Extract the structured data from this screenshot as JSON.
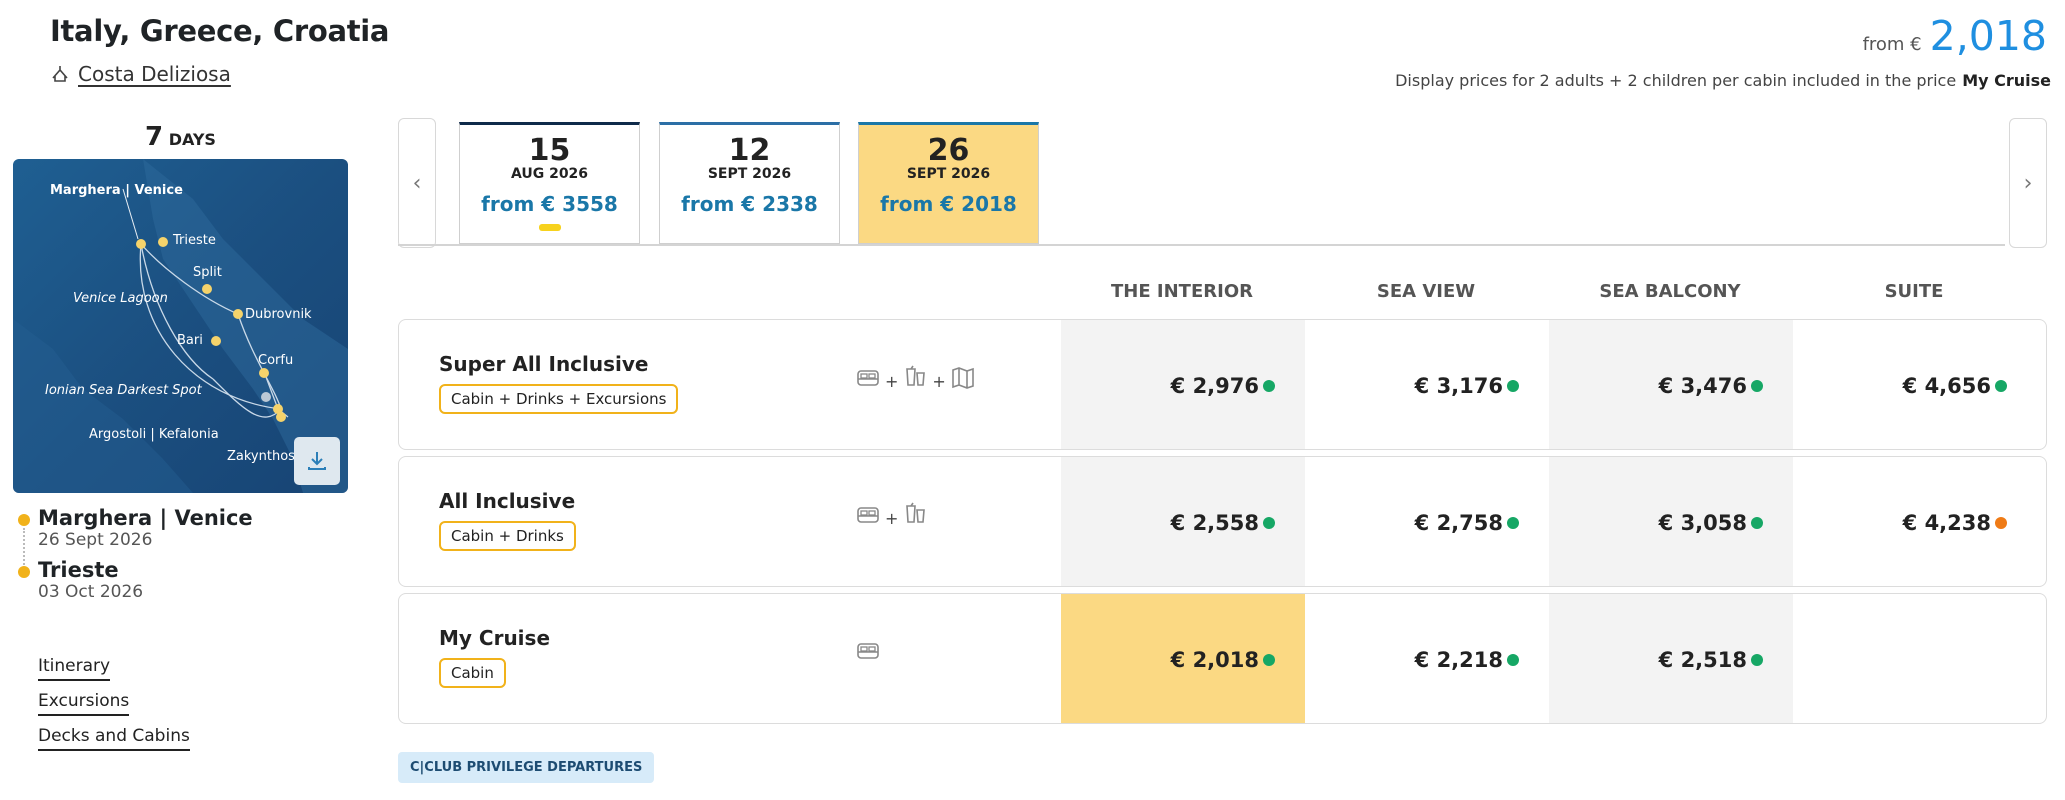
{
  "header": {
    "title": "Italy, Greece, Croatia",
    "ship": "Costa Deliziosa",
    "from_label": "from €",
    "from_price": "2,018",
    "note": "Display prices for 2 adults + 2 children per cabin included in the price",
    "note_bold": "My Cruise"
  },
  "sidebar": {
    "days_num": "7",
    "days_label": "DAYS",
    "map_labels": {
      "start": "Marghera | Venice",
      "trieste": "Trieste",
      "split": "Split",
      "lagoon": "Venice Lagoon",
      "dubrovnik": "Dubrovnik",
      "bari": "Bari",
      "corfu": "Corfu",
      "ionian": "Ionian Sea Darkest Spot",
      "argostoli": "Argostoli | Kefalonia",
      "zakynthos": "Zakynthos"
    },
    "ports": [
      {
        "name": "Marghera | Venice",
        "date": "26 Sept 2026"
      },
      {
        "name": "Trieste",
        "date": "03 Oct 2026"
      }
    ],
    "links": [
      "Itinerary",
      "Excursions",
      "Decks and Cabins"
    ]
  },
  "dates": [
    {
      "day": "15",
      "month": "AUG 2026",
      "price": "from € 3558"
    },
    {
      "day": "12",
      "month": "SEPT 2026",
      "price": "from € 2338"
    },
    {
      "day": "26",
      "month": "SEPT 2026",
      "price": "from € 2018"
    }
  ],
  "nav": {
    "prev": "‹",
    "next": "›"
  },
  "columns": [
    "THE INTERIOR",
    "SEA VIEW",
    "SEA BALCONY",
    "SUITE"
  ],
  "packages": [
    {
      "name": "Super All Inclusive",
      "tag": "Cabin + Drinks + Excursions",
      "prices": [
        "€ 2,976",
        "€ 3,176",
        "€ 3,476",
        "€ 4,656"
      ]
    },
    {
      "name": "All Inclusive",
      "tag": "Cabin + Drinks",
      "prices": [
        "€ 2,558",
        "€ 2,758",
        "€ 3,058",
        "€ 4,238"
      ]
    },
    {
      "name": "My Cruise",
      "tag": "Cabin",
      "prices": [
        "€ 2,018",
        "€ 2,218",
        "€ 2,518",
        ""
      ]
    }
  ],
  "icons": {
    "plus": "+"
  },
  "club": "C|CLUB PRIVILEGE DEPARTURES",
  "colors": {
    "accent": "#1f8fe0",
    "available": "#16a765",
    "limited": "#ef7b16",
    "selected": "#fbd983",
    "tag_border": "#f1b21a"
  }
}
